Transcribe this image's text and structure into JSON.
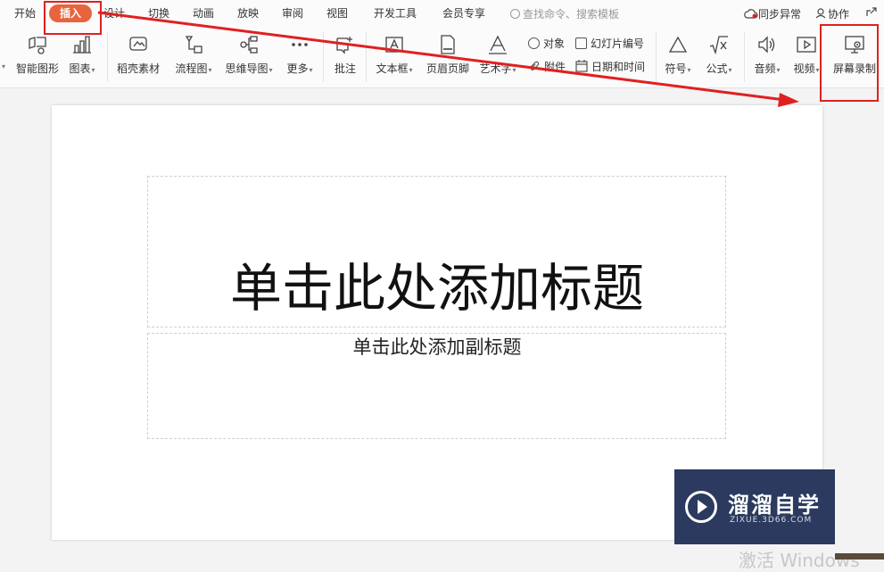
{
  "menu": {
    "tabs": [
      "开始",
      "插入",
      "设计",
      "切换",
      "动画",
      "放映",
      "审阅",
      "视图",
      "开发工具",
      "会员专享"
    ],
    "active_tab": "插入",
    "search_placeholder": "查找命令、搜索模板",
    "sync_label": "同步异常",
    "collab_label": "协作"
  },
  "ribbon": {
    "smart_shape": "智能图形",
    "chart": "图表",
    "docer_material": "稻壳素材",
    "flowchart": "流程图",
    "mindmap": "思维导图",
    "more": "更多",
    "comment": "批注",
    "textbox": "文本框",
    "header_footer": "页眉页脚",
    "wordart": "艺术字",
    "object": "对象",
    "attachment": "附件",
    "slide_number": "幻灯片编号",
    "datetime": "日期和时间",
    "symbol": "符号",
    "formula": "公式",
    "audio": "音频",
    "video": "视频",
    "screen_record": "屏幕录制"
  },
  "slide": {
    "title_placeholder": "单击此处添加标题",
    "subtitle_placeholder": "单击此处添加副标题"
  },
  "watermark": {
    "title": "溜溜自学",
    "subtitle": "ZIXUE.3D66.COM"
  },
  "system": {
    "activate_windows": "激活 Windows"
  },
  "colors": {
    "active_tab": "#e8643c",
    "annotation_red": "#e02020",
    "watermark_bg": "#2b3a5e"
  }
}
